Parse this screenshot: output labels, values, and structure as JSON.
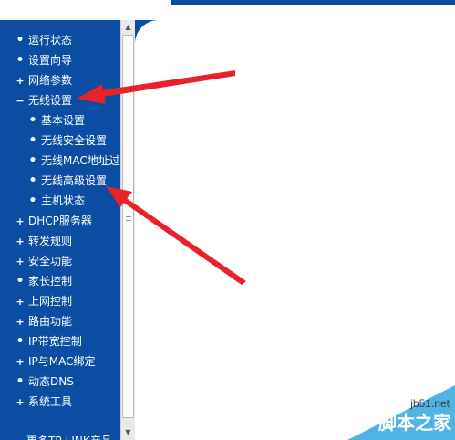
{
  "sidebar": {
    "items": [
      {
        "label": "运行状态",
        "marker": "•"
      },
      {
        "label": "设置向导",
        "marker": "•"
      },
      {
        "label": "网络参数",
        "marker": "+"
      },
      {
        "label": "无线设置",
        "marker": "−"
      },
      {
        "label": "基本设置",
        "marker": "•"
      },
      {
        "label": "无线安全设置",
        "marker": "•"
      },
      {
        "label": "无线MAC地址过滤",
        "marker": "•"
      },
      {
        "label": "无线高级设置",
        "marker": "•"
      },
      {
        "label": "主机状态",
        "marker": "•"
      },
      {
        "label": "DHCP服务器",
        "marker": "+"
      },
      {
        "label": "转发规则",
        "marker": "+"
      },
      {
        "label": "安全功能",
        "marker": "+"
      },
      {
        "label": "家长控制",
        "marker": "•"
      },
      {
        "label": "上网控制",
        "marker": "+"
      },
      {
        "label": "路由功能",
        "marker": "+"
      },
      {
        "label": "IP带宽控制",
        "marker": "•"
      },
      {
        "label": "IP与MAC绑定",
        "marker": "+"
      },
      {
        "label": "动态DNS",
        "marker": "•"
      },
      {
        "label": "系统工具",
        "marker": "+"
      }
    ],
    "bottom_link": "更多TP-LINK产品"
  },
  "scrollbar": {
    "up_arrow": "▲",
    "down_arrow": "▼"
  },
  "watermark": {
    "site": "jb51.net",
    "name": "脚本之家"
  },
  "colors": {
    "sidebar_bg": "#0b4da2",
    "arrow": "#e8212a",
    "watermark_bg": "#4fb3e6"
  },
  "annotations": {
    "arrows": [
      "arrow-to-wireless-settings",
      "arrow-to-wireless-advanced-settings"
    ]
  }
}
